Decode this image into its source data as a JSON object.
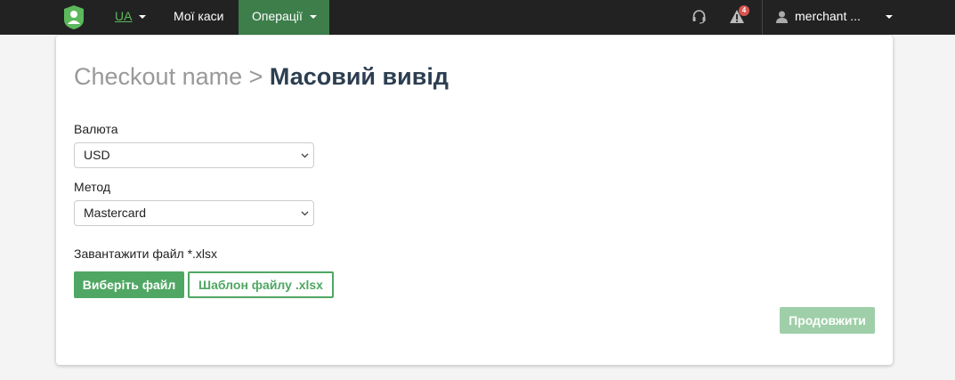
{
  "navbar": {
    "language": "UA",
    "my_cash_label": "Мої каси",
    "operations_label": "Операції",
    "alerts_count": "4",
    "user_name": "merchant ..."
  },
  "page": {
    "title_prefix": "Checkout name >",
    "title_main": "Масовий вивід"
  },
  "form": {
    "currency_label": "Валюта",
    "currency_value": "USD",
    "method_label": "Метод",
    "method_value": "Mastercard",
    "upload_label": "Завантажити файл *.xlsx",
    "choose_file_button": "Виберіть файл",
    "template_button": "Шаблон файлу .xlsx",
    "continue_button": "Продовжити"
  },
  "colors": {
    "navbar_bg": "#222222",
    "active_tab_bg": "#3d7e4b",
    "accent_green": "#4fa763",
    "disabled_green": "#9fcfa8",
    "badge_red": "#d9534f"
  },
  "icons": [
    "logo-icon",
    "headset-icon",
    "alert-icon",
    "user-icon",
    "chevron-down-icon"
  ]
}
